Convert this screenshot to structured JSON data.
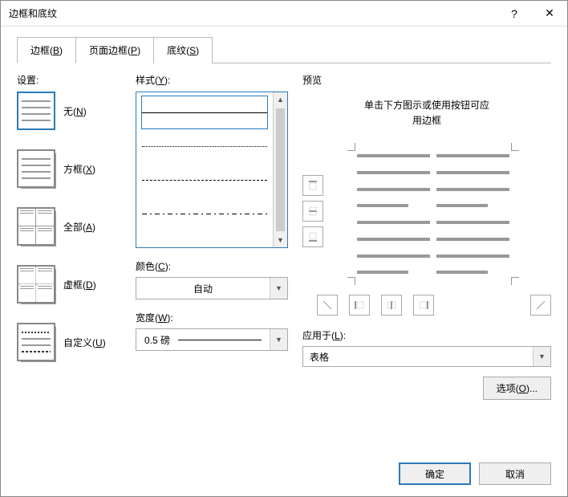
{
  "titlebar": {
    "title": "边框和底纹"
  },
  "tabs": {
    "borders": {
      "text": "边框",
      "accel": "B"
    },
    "page": {
      "text": "页面边框",
      "accel": "P"
    },
    "shading": {
      "text": "底纹",
      "accel": "S"
    }
  },
  "settings": {
    "label": "设置:",
    "none": {
      "text": "无",
      "accel": "N"
    },
    "box": {
      "text": "方框",
      "accel": "X"
    },
    "all": {
      "text": "全部",
      "accel": "A"
    },
    "grid": {
      "text": "虚框",
      "accel": "D"
    },
    "custom": {
      "text": "自定义",
      "accel": "U"
    }
  },
  "style": {
    "label": "样式",
    "accel": "Y",
    "color_label": "颜色",
    "color_accel": "C",
    "color_value": "自动",
    "width_label": "宽度",
    "width_accel": "W",
    "width_value": "0.5 磅"
  },
  "preview": {
    "label": "预览",
    "hint1": "单击下方图示或使用按钮可应",
    "hint2": "用边框",
    "apply_label": "应用于",
    "apply_accel": "L",
    "apply_value": "表格",
    "options_label": "选项",
    "options_accel": "O"
  },
  "footer": {
    "ok": "确定",
    "cancel": "取消"
  }
}
